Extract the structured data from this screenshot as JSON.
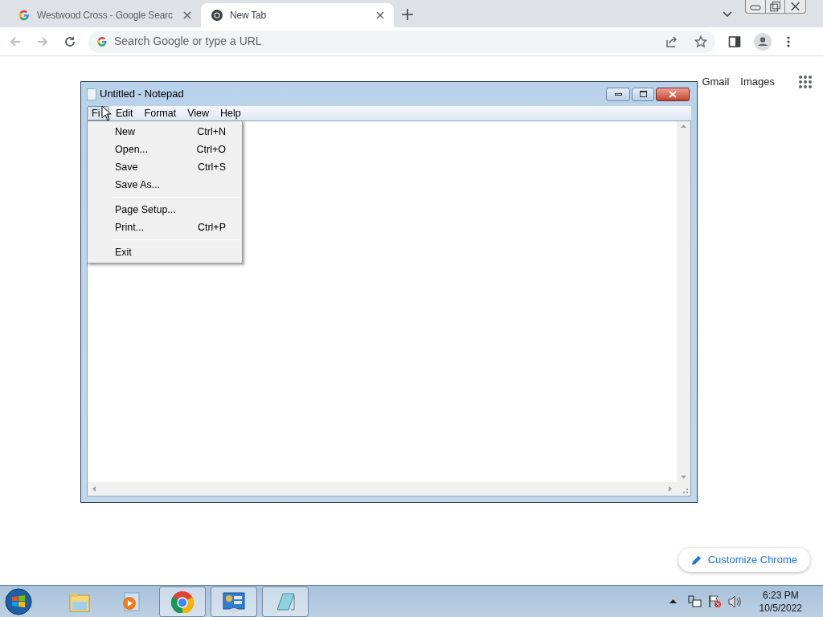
{
  "browser": {
    "tabs": [
      {
        "title": "Westwood Cross - Google Searc",
        "selected": false
      },
      {
        "title": "New Tab",
        "selected": true
      }
    ],
    "omnibox": {
      "placeholder": "Search Google or type a URL"
    },
    "page": {
      "links": [
        "Gmail",
        "Images"
      ],
      "customize_button": "Customize Chrome"
    }
  },
  "notepad": {
    "title": "Untitled - Notepad",
    "menu": [
      {
        "label": "Fi",
        "selected": true
      },
      {
        "label": "Edit",
        "selected": false
      },
      {
        "label": "Format",
        "selected": false
      },
      {
        "label": "View",
        "selected": false
      },
      {
        "label": "Help",
        "selected": false
      }
    ],
    "file_menu": [
      {
        "kind": "item",
        "label": "New",
        "shortcut": "Ctrl+N"
      },
      {
        "kind": "item",
        "label": "Open...",
        "shortcut": "Ctrl+O"
      },
      {
        "kind": "item",
        "label": "Save",
        "shortcut": "Ctrl+S"
      },
      {
        "kind": "item",
        "label": "Save As..."
      },
      {
        "kind": "separator"
      },
      {
        "kind": "item",
        "label": "Page Setup..."
      },
      {
        "kind": "item",
        "label": "Print...",
        "shortcut": "Ctrl+P"
      },
      {
        "kind": "separator"
      },
      {
        "kind": "item",
        "label": "Exit"
      }
    ]
  },
  "taskbar": {
    "items": [
      {
        "running": false
      },
      {
        "running": false
      },
      {
        "running": true
      },
      {
        "running": true
      },
      {
        "running": true
      }
    ],
    "clock": {
      "time": "6:23 PM",
      "date": "10/5/2022"
    }
  }
}
